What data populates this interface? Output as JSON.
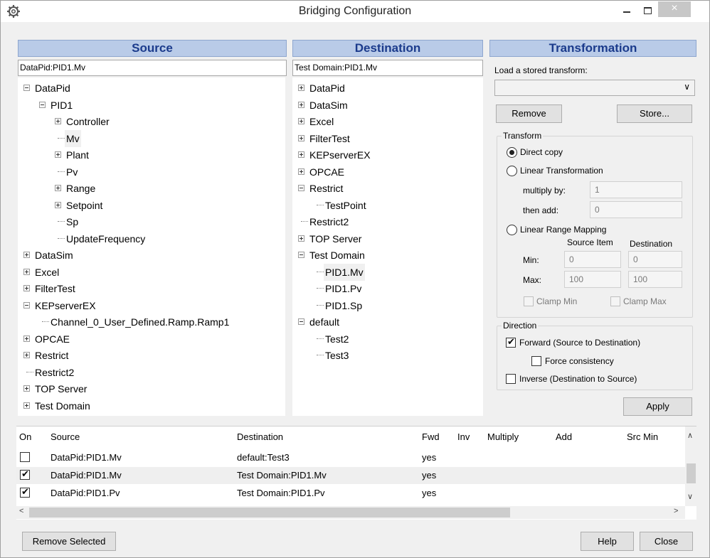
{
  "window": {
    "title": "Bridging Configuration",
    "close_glyph": "×"
  },
  "source": {
    "header": "Source",
    "path": "DataPid:PID1.Mv",
    "tree": [
      {
        "label": "DataPid",
        "depth": 0,
        "expander": "minus"
      },
      {
        "label": "PID1",
        "depth": 1,
        "expander": "minus"
      },
      {
        "label": "Controller",
        "depth": 2,
        "expander": "plus"
      },
      {
        "label": "Mv",
        "depth": 2,
        "expander": "none",
        "selected": true
      },
      {
        "label": "Plant",
        "depth": 2,
        "expander": "plus"
      },
      {
        "label": "Pv",
        "depth": 2,
        "expander": "none"
      },
      {
        "label": "Range",
        "depth": 2,
        "expander": "plus"
      },
      {
        "label": "Setpoint",
        "depth": 2,
        "expander": "plus"
      },
      {
        "label": "Sp",
        "depth": 2,
        "expander": "none"
      },
      {
        "label": "UpdateFrequency",
        "depth": 2,
        "expander": "none"
      },
      {
        "label": "DataSim",
        "depth": 0,
        "expander": "plus"
      },
      {
        "label": "Excel",
        "depth": 0,
        "expander": "plus"
      },
      {
        "label": "FilterTest",
        "depth": 0,
        "expander": "plus"
      },
      {
        "label": "KEPserverEX",
        "depth": 0,
        "expander": "minus"
      },
      {
        "label": "Channel_0_User_Defined.Ramp.Ramp1",
        "depth": 1,
        "expander": "none"
      },
      {
        "label": "OPCAE",
        "depth": 0,
        "expander": "plus"
      },
      {
        "label": "Restrict",
        "depth": 0,
        "expander": "plus"
      },
      {
        "label": "Restrict2",
        "depth": 0,
        "expander": "none"
      },
      {
        "label": "TOP Server",
        "depth": 0,
        "expander": "plus"
      },
      {
        "label": "Test Domain",
        "depth": 0,
        "expander": "plus"
      }
    ]
  },
  "destination": {
    "header": "Destination",
    "path": "Test Domain:PID1.Mv",
    "tree": [
      {
        "label": "DataPid",
        "depth": 0,
        "expander": "plus"
      },
      {
        "label": "DataSim",
        "depth": 0,
        "expander": "plus"
      },
      {
        "label": "Excel",
        "depth": 0,
        "expander": "plus"
      },
      {
        "label": "FilterTest",
        "depth": 0,
        "expander": "plus"
      },
      {
        "label": "KEPserverEX",
        "depth": 0,
        "expander": "plus"
      },
      {
        "label": "OPCAE",
        "depth": 0,
        "expander": "plus"
      },
      {
        "label": "Restrict",
        "depth": 0,
        "expander": "minus"
      },
      {
        "label": "TestPoint",
        "depth": 1,
        "expander": "none"
      },
      {
        "label": "Restrict2",
        "depth": 0,
        "expander": "none"
      },
      {
        "label": "TOP Server",
        "depth": 0,
        "expander": "plus"
      },
      {
        "label": "Test Domain",
        "depth": 0,
        "expander": "minus"
      },
      {
        "label": "PID1.Mv",
        "depth": 1,
        "expander": "none",
        "selected": true
      },
      {
        "label": "PID1.Pv",
        "depth": 1,
        "expander": "none"
      },
      {
        "label": "PID1.Sp",
        "depth": 1,
        "expander": "none"
      },
      {
        "label": "default",
        "depth": 0,
        "expander": "minus"
      },
      {
        "label": "Test2",
        "depth": 1,
        "expander": "none"
      },
      {
        "label": "Test3",
        "depth": 1,
        "expander": "none"
      }
    ]
  },
  "transformation": {
    "header": "Transformation",
    "load_label": "Load a stored transform:",
    "stored_transform_value": "",
    "remove_label": "Remove",
    "store_label": "Store...",
    "transform_group": "Transform",
    "direct_copy": "Direct copy",
    "linear_transformation": "Linear Transformation",
    "multiply_by_label": "multiply by:",
    "multiply_by_value": "1",
    "then_add_label": "then add:",
    "then_add_value": "0",
    "linear_range_mapping": "Linear Range Mapping",
    "source_item_label": "Source Item",
    "destination_label": "Destination",
    "min_label": "Min:",
    "max_label": "Max:",
    "src_min_value": "0",
    "dst_min_value": "0",
    "src_max_value": "100",
    "dst_max_value": "100",
    "clamp_min": "Clamp Min",
    "clamp_max": "Clamp Max",
    "direction_group": "Direction",
    "forward": "Forward (Source to Destination)",
    "force_consistency": "Force consistency",
    "inverse": "Inverse (Destination to Source)",
    "apply_label": "Apply"
  },
  "table": {
    "columns": [
      "On",
      "Source",
      "Destination",
      "Fwd",
      "Inv",
      "Multiply",
      "Add",
      "Src Min"
    ],
    "rows": [
      {
        "on": false,
        "source": "DataPid:PID1.Mv",
        "destination": "default:Test3",
        "fwd": "yes"
      },
      {
        "on": true,
        "source": "DataPid:PID1.Mv",
        "destination": "Test Domain:PID1.Mv",
        "fwd": "yes"
      },
      {
        "on": true,
        "source": "DataPid:PID1.Pv",
        "destination": "Test Domain:PID1.Pv",
        "fwd": "yes"
      }
    ]
  },
  "footer": {
    "remove_selected": "Remove Selected",
    "help": "Help",
    "close": "Close"
  }
}
